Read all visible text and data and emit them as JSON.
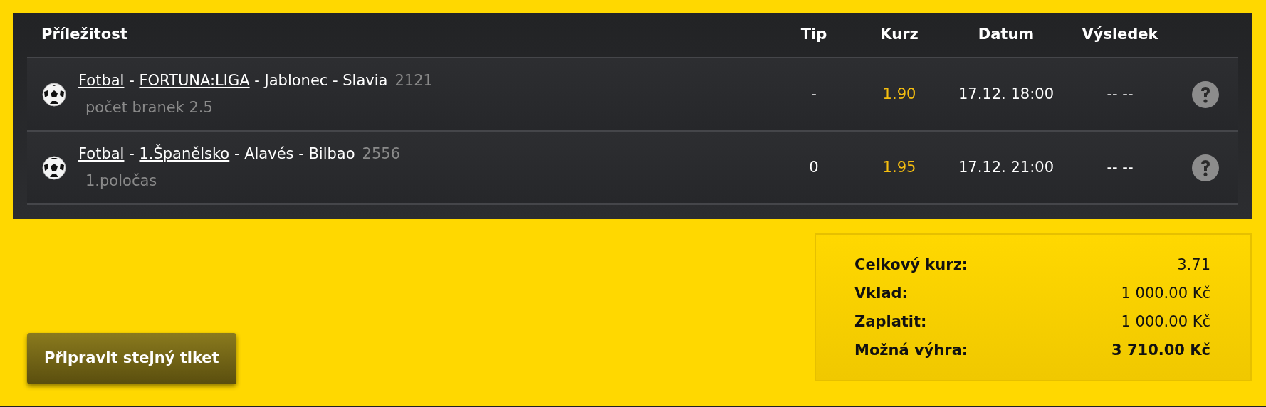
{
  "table": {
    "columns": [
      {
        "label": "Příležitost"
      },
      {
        "label": "Tip"
      },
      {
        "label": "Kurz"
      },
      {
        "label": "Datum"
      },
      {
        "label": "Výsledek"
      }
    ],
    "rows": [
      {
        "title_parts": [
          {
            "text": "Fotbal",
            "link": true
          },
          {
            "text": " - ",
            "link": false
          },
          {
            "text": "FORTUNA:LIGA",
            "link": true
          },
          {
            "text": " - Jablonec - Slavia",
            "link": false
          }
        ],
        "code": "2121",
        "market": "počet branek 2.5",
        "tip": "-",
        "odds": "1.90",
        "date": "17.12. 18:00",
        "result": "-- --"
      },
      {
        "title_parts": [
          {
            "text": "Fotbal",
            "link": true
          },
          {
            "text": " - ",
            "link": false
          },
          {
            "text": "1.Španělsko",
            "link": true
          },
          {
            "text": " - Alavés - Bilbao",
            "link": false
          }
        ],
        "code": "2556",
        "market": "1.poločas",
        "tip": "0",
        "odds": "1.95",
        "date": "17.12. 21:00",
        "result": "-- --"
      }
    ]
  },
  "button": {
    "label": "Připravit stejný tiket"
  },
  "summary": [
    {
      "label": "Celkový kurz:",
      "value": "3.71",
      "emphasized": false
    },
    {
      "label": "Vklad:",
      "value": "1 000.00 Kč",
      "emphasized": false
    },
    {
      "label": "Zaplatit:",
      "value": "1 000.00 Kč",
      "emphasized": false
    },
    {
      "label": "Možná výhra:",
      "value": "3 710.00 Kč",
      "emphasized": true
    }
  ]
}
